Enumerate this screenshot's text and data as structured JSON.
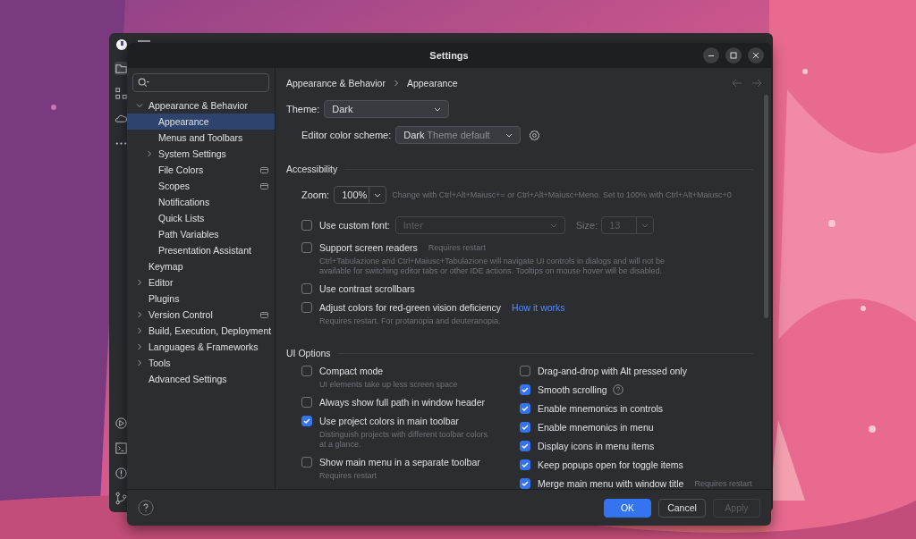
{
  "dialog": {
    "title": "Settings"
  },
  "sidebar": {
    "items": [
      {
        "label": "Appearance & Behavior",
        "kind": "folder",
        "expanded": true,
        "selected": false,
        "project_level": false,
        "children": [
          {
            "label": "Appearance",
            "kind": "page",
            "selected": true,
            "project_level": false
          },
          {
            "label": "Menus and Toolbars",
            "kind": "page",
            "selected": false,
            "project_level": false
          },
          {
            "label": "System Settings",
            "kind": "folder",
            "expanded": false,
            "selected": false,
            "project_level": false
          },
          {
            "label": "File Colors",
            "kind": "page",
            "selected": false,
            "project_level": true
          },
          {
            "label": "Scopes",
            "kind": "page",
            "selected": false,
            "project_level": true
          },
          {
            "label": "Notifications",
            "kind": "page",
            "selected": false,
            "project_level": false
          },
          {
            "label": "Quick Lists",
            "kind": "page",
            "selected": false,
            "project_level": false
          },
          {
            "label": "Path Variables",
            "kind": "page",
            "selected": false,
            "project_level": false
          },
          {
            "label": "Presentation Assistant",
            "kind": "page",
            "selected": false,
            "project_level": false
          }
        ]
      },
      {
        "label": "Keymap",
        "kind": "page",
        "selected": false,
        "project_level": false
      },
      {
        "label": "Editor",
        "kind": "folder",
        "expanded": false,
        "selected": false,
        "project_level": false
      },
      {
        "label": "Plugins",
        "kind": "page",
        "selected": false,
        "project_level": false
      },
      {
        "label": "Version Control",
        "kind": "folder",
        "expanded": false,
        "selected": false,
        "project_level": true
      },
      {
        "label": "Build, Execution, Deployment",
        "kind": "folder",
        "expanded": false,
        "selected": false,
        "project_level": false
      },
      {
        "label": "Languages & Frameworks",
        "kind": "folder",
        "expanded": false,
        "selected": false,
        "project_level": false
      },
      {
        "label": "Tools",
        "kind": "folder",
        "expanded": false,
        "selected": false,
        "project_level": false
      },
      {
        "label": "Advanced Settings",
        "kind": "page",
        "selected": false,
        "project_level": false
      }
    ]
  },
  "breadcrumb": [
    "Appearance & Behavior",
    "Appearance"
  ],
  "theme": {
    "label": "Theme:",
    "value": "Dark"
  },
  "color_scheme": {
    "label": "Editor color scheme:",
    "value": "Dark",
    "hint": "Theme default"
  },
  "accessibility": {
    "title": "Accessibility",
    "zoom": {
      "label": "Zoom:",
      "value": "100%",
      "hint": "Change with Ctrl+Alt+Maiusc+= or Ctrl+Alt+Maiusc+Meno. Set to 100% with Ctrl+Alt+Maiusc+0"
    },
    "options": [
      {
        "kind": "font",
        "label": "Use custom font:",
        "checked": false,
        "font": "Inter",
        "size_label": "Size:",
        "size": "13"
      },
      {
        "kind": "check",
        "label": "Support screen readers",
        "checked": false,
        "note": "Requires restart",
        "description": "Ctrl+Tabulazione and Ctrl+Maiusc+Tabulazione will navigate UI controls in dialogs and will not be available for switching editor tabs or other IDE actions. Tooltips on mouse hover will be disabled."
      },
      {
        "kind": "check",
        "label": "Use contrast scrollbars",
        "checked": false
      },
      {
        "kind": "check",
        "label": "Adjust colors for red-green vision deficiency",
        "checked": false,
        "link": "How it works",
        "description": "Requires restart. For protanopia and deuteranopia."
      }
    ]
  },
  "ui_options": {
    "title": "UI Options",
    "left": [
      {
        "label": "Compact mode",
        "checked": false,
        "description": "UI elements take up less screen space"
      },
      {
        "label": "Always show full path in window header",
        "checked": false
      },
      {
        "label": "Use project colors in main toolbar",
        "checked": true,
        "description": "Distinguish projects with different toolbar colors at a glance."
      },
      {
        "label": "Show main menu in a separate toolbar",
        "checked": false,
        "description": "Requires restart"
      }
    ],
    "right": [
      {
        "label": "Drag-and-drop with Alt pressed only",
        "checked": false
      },
      {
        "label": "Smooth scrolling",
        "checked": true,
        "help": true
      },
      {
        "label": "Enable mnemonics in controls",
        "checked": true
      },
      {
        "label": "Enable mnemonics in menu",
        "checked": true
      },
      {
        "label": "Display icons in menu items",
        "checked": true
      },
      {
        "label": "Keep popups open for toggle items",
        "checked": true
      },
      {
        "label": "Merge main menu with window title",
        "checked": true,
        "note": "Requires restart"
      }
    ]
  },
  "buttons": [
    {
      "label": "OK",
      "kind": "primary",
      "disabled": false
    },
    {
      "label": "Cancel",
      "kind": "normal",
      "disabled": false
    },
    {
      "label": "Apply",
      "kind": "normal",
      "disabled": true
    }
  ]
}
